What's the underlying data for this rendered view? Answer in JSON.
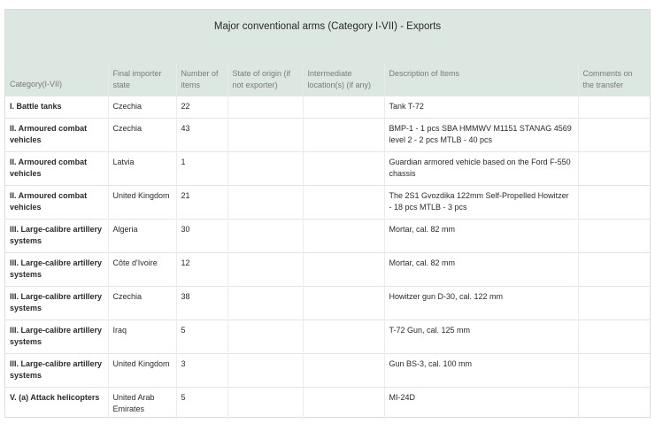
{
  "title": "Major conventional arms (Category I-VII) - Exports",
  "columns": [
    "Category(I-VII)",
    "Final importer state",
    "Number of items",
    "State of origin (if not exporter)",
    "Intermediate location(s) (if any)",
    "Description of Items",
    "Comments on the transfer"
  ],
  "rows": [
    {
      "category": "I. Battle tanks",
      "importer": "Czechia",
      "number": "22",
      "origin": "",
      "intermediate": "",
      "description": "Tank T-72",
      "comments": ""
    },
    {
      "category": "II. Armoured combat vehicles",
      "importer": "Czechia",
      "number": "43",
      "origin": "",
      "intermediate": "",
      "description": "BMP-1 - 1 pcs SBA HMMWV M1151 STANAG 4569 level 2 - 2 pcs MTLB - 40 pcs",
      "comments": ""
    },
    {
      "category": "II. Armoured combat vehicles",
      "importer": "Latvia",
      "number": "1",
      "origin": "",
      "intermediate": "",
      "description": "Guardian armored vehicle based on the Ford F-550 chassis",
      "comments": ""
    },
    {
      "category": "II. Armoured combat vehicles",
      "importer": "United Kingdom",
      "number": "21",
      "origin": "",
      "intermediate": "",
      "description": "The 2S1 Gvozdika 122mm Self-Propelled Howitzer - 18 pcs MTLB - 3 pcs",
      "comments": ""
    },
    {
      "category": "III. Large-calibre artillery systems",
      "importer": "Algeria",
      "number": "30",
      "origin": "",
      "intermediate": "",
      "description": "Mortar, cal. 82 mm",
      "comments": ""
    },
    {
      "category": "III. Large-calibre artillery systems",
      "importer": "Côte d'Ivoire",
      "number": "12",
      "origin": "",
      "intermediate": "",
      "description": "Mortar, cal. 82 mm",
      "comments": ""
    },
    {
      "category": "III. Large-calibre artillery systems",
      "importer": "Czechia",
      "number": "38",
      "origin": "",
      "intermediate": "",
      "description": "Howitzer gun D-30, cal. 122 mm",
      "comments": ""
    },
    {
      "category": "III. Large-calibre artillery systems",
      "importer": "Iraq",
      "number": "5",
      "origin": "",
      "intermediate": "",
      "description": "T-72 Gun, cal. 125 mm",
      "comments": ""
    },
    {
      "category": "III. Large-calibre artillery systems",
      "importer": "United Kingdom",
      "number": "3",
      "origin": "",
      "intermediate": "",
      "description": "Gun BS-3, cal. 100 mm",
      "comments": ""
    },
    {
      "category": "V. (a) Attack helicopters",
      "importer": "United Arab Emirates",
      "number": "5",
      "origin": "",
      "intermediate": "",
      "description": "MI-24D",
      "comments": ""
    }
  ]
}
